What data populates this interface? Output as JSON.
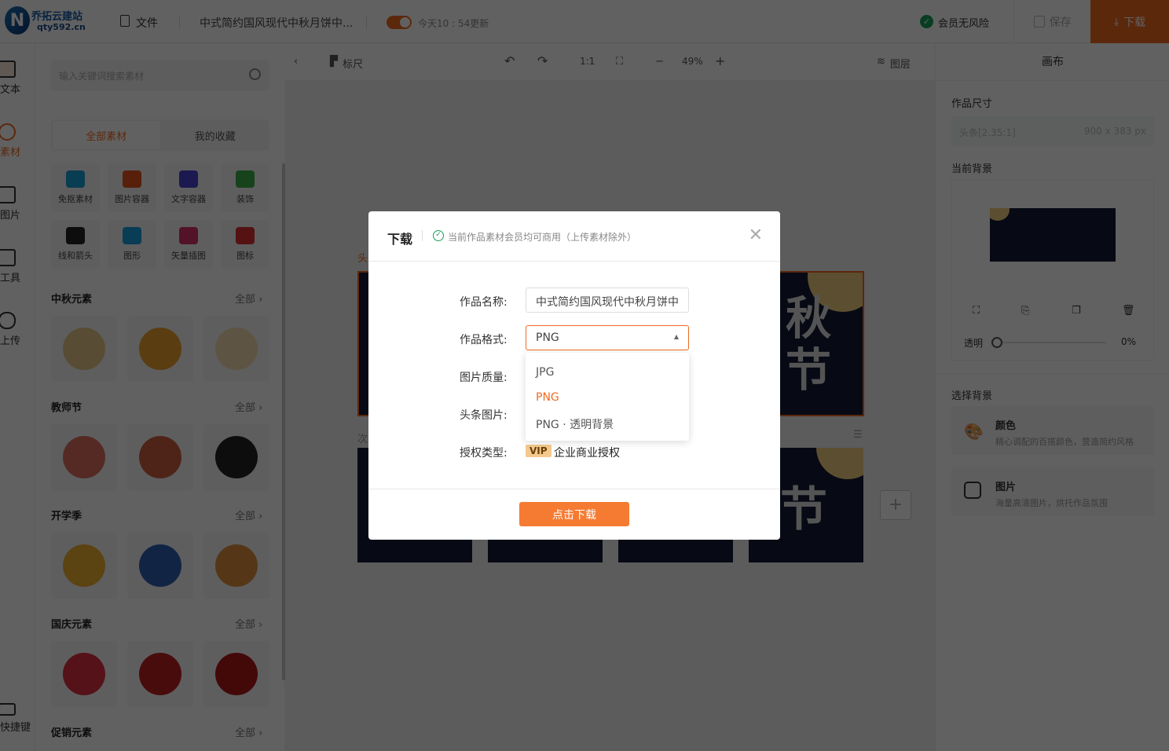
{
  "header": {
    "logo_name": "乔拓云建站",
    "logo_domain": "qty592.cn",
    "file_label": "文件",
    "doc_title": "中式简约国风现代中秋月饼中...",
    "update_text": "今天10 : 54更新",
    "member_badge": "会员无风险",
    "save_label": "保存",
    "download_label": "下载",
    "accent": "#f06b20"
  },
  "rail": {
    "items": [
      {
        "label": "文本",
        "icon": "text-icon"
      },
      {
        "label": "素材",
        "icon": "material-icon",
        "active": true
      },
      {
        "label": "图片",
        "icon": "image-icon"
      },
      {
        "label": "工具",
        "icon": "toolbox-icon"
      },
      {
        "label": "上传",
        "icon": "upload-cloud-icon"
      }
    ],
    "shortcut_label": "快捷键"
  },
  "materials": {
    "search_placeholder": "输入关键词搜索素材",
    "tabs": [
      "全部素材",
      "我的收藏"
    ],
    "categories": [
      {
        "label": "免抠素材",
        "color": "#1aa0d8"
      },
      {
        "label": "图片容器",
        "color": "#e8531c"
      },
      {
        "label": "文字容器",
        "color": "#4a3fd1"
      },
      {
        "label": "装饰",
        "color": "#3db04a"
      },
      {
        "label": "线和箭头",
        "color": "#222"
      },
      {
        "label": "图形",
        "color": "#1a9de0"
      },
      {
        "label": "矢量插图",
        "color": "#d8306a"
      },
      {
        "label": "图标",
        "color": "#e03030"
      }
    ],
    "sections": [
      {
        "title": "中秋元素",
        "all": "全部"
      },
      {
        "title": "教师节",
        "all": "全部"
      },
      {
        "title": "开学季",
        "all": "全部"
      },
      {
        "title": "国庆元素",
        "all": "全部"
      },
      {
        "title": "促销元素",
        "all": "全部"
      }
    ]
  },
  "canvas_toolbar": {
    "ruler_label": "标尺",
    "ratio_label": "1:1",
    "zoom": "49%",
    "layers_label": "图层"
  },
  "canvas": {
    "page1_label": "头",
    "page2_label": "次",
    "page1_text": "秋节",
    "page2_text": "节"
  },
  "right_panel": {
    "title": "画布",
    "size_label": "作品尺寸",
    "size_name": "头条[2.35:1]",
    "size_value": "900 x 383 px",
    "bg_label": "当前背景",
    "opacity_label": "透明",
    "opacity_value": "0%",
    "opacity": 0,
    "choose_label": "选择背景",
    "options": [
      {
        "title": "颜色",
        "desc": "精心调配的百搭颜色，营造简约风格"
      },
      {
        "title": "图片",
        "desc": "海量高清图片，烘托作品氛围"
      }
    ]
  },
  "modal": {
    "title": "下载",
    "notice": "当前作品素材会员均可商用（上传素材除外）",
    "name_label": "作品名称:",
    "name_value": "中式简约国风现代中秋月饼中",
    "format_label": "作品格式:",
    "format_value": "PNG",
    "format_options": [
      "JPG",
      "PNG",
      "PNG · 透明背景"
    ],
    "format_selected": "PNG",
    "quality_label": "图片质量:",
    "headline_label": "头条图片:",
    "license_label": "授权类型:",
    "license_badge": "VIP",
    "license_value": "企业商业授权",
    "submit_label": "点击下载"
  }
}
